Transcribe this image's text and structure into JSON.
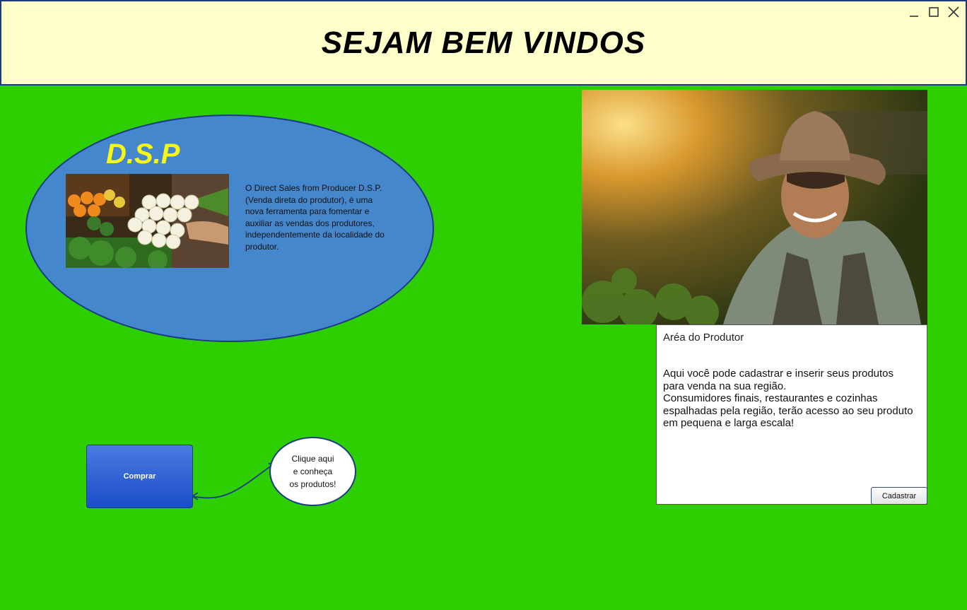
{
  "header": {
    "title": "SEJAM BEM VINDOS",
    "window_controls": [
      "minimize-icon",
      "maximize-icon",
      "close-icon"
    ]
  },
  "dsp": {
    "title": "D.S.P",
    "description": "O Direct Sales from Producer D.S.P. (Venda direta do produtor), é uma nova ferramenta para fomentar e auxiliar as vendas dos produtores, independentemente da localidade do produtor.",
    "image": "vegetables-market-photo"
  },
  "buy": {
    "button_label": "Comprar"
  },
  "bubble": {
    "line1": "Clique aqui",
    "line2": "e conheça",
    "line3": "os produtos!"
  },
  "producer": {
    "image": "smiling-farmer-photo",
    "title": "Aréa do Produtor",
    "text_line1": "Aqui você pode cadastrar e inserir seus produtos para venda na sua região.",
    "text_line2": "Consumidores finais, restaurantes e cozinhas espalhadas pela região, terão acesso ao seu produto em pequena e larga escala!",
    "button_label": "Cadastrar"
  },
  "colors": {
    "background": "#2ecf00",
    "header_bg": "#ffffcc",
    "ellipse_bg": "#4487cc",
    "title_yellow": "#f6f617",
    "button_blue": "#1c4ec8"
  }
}
